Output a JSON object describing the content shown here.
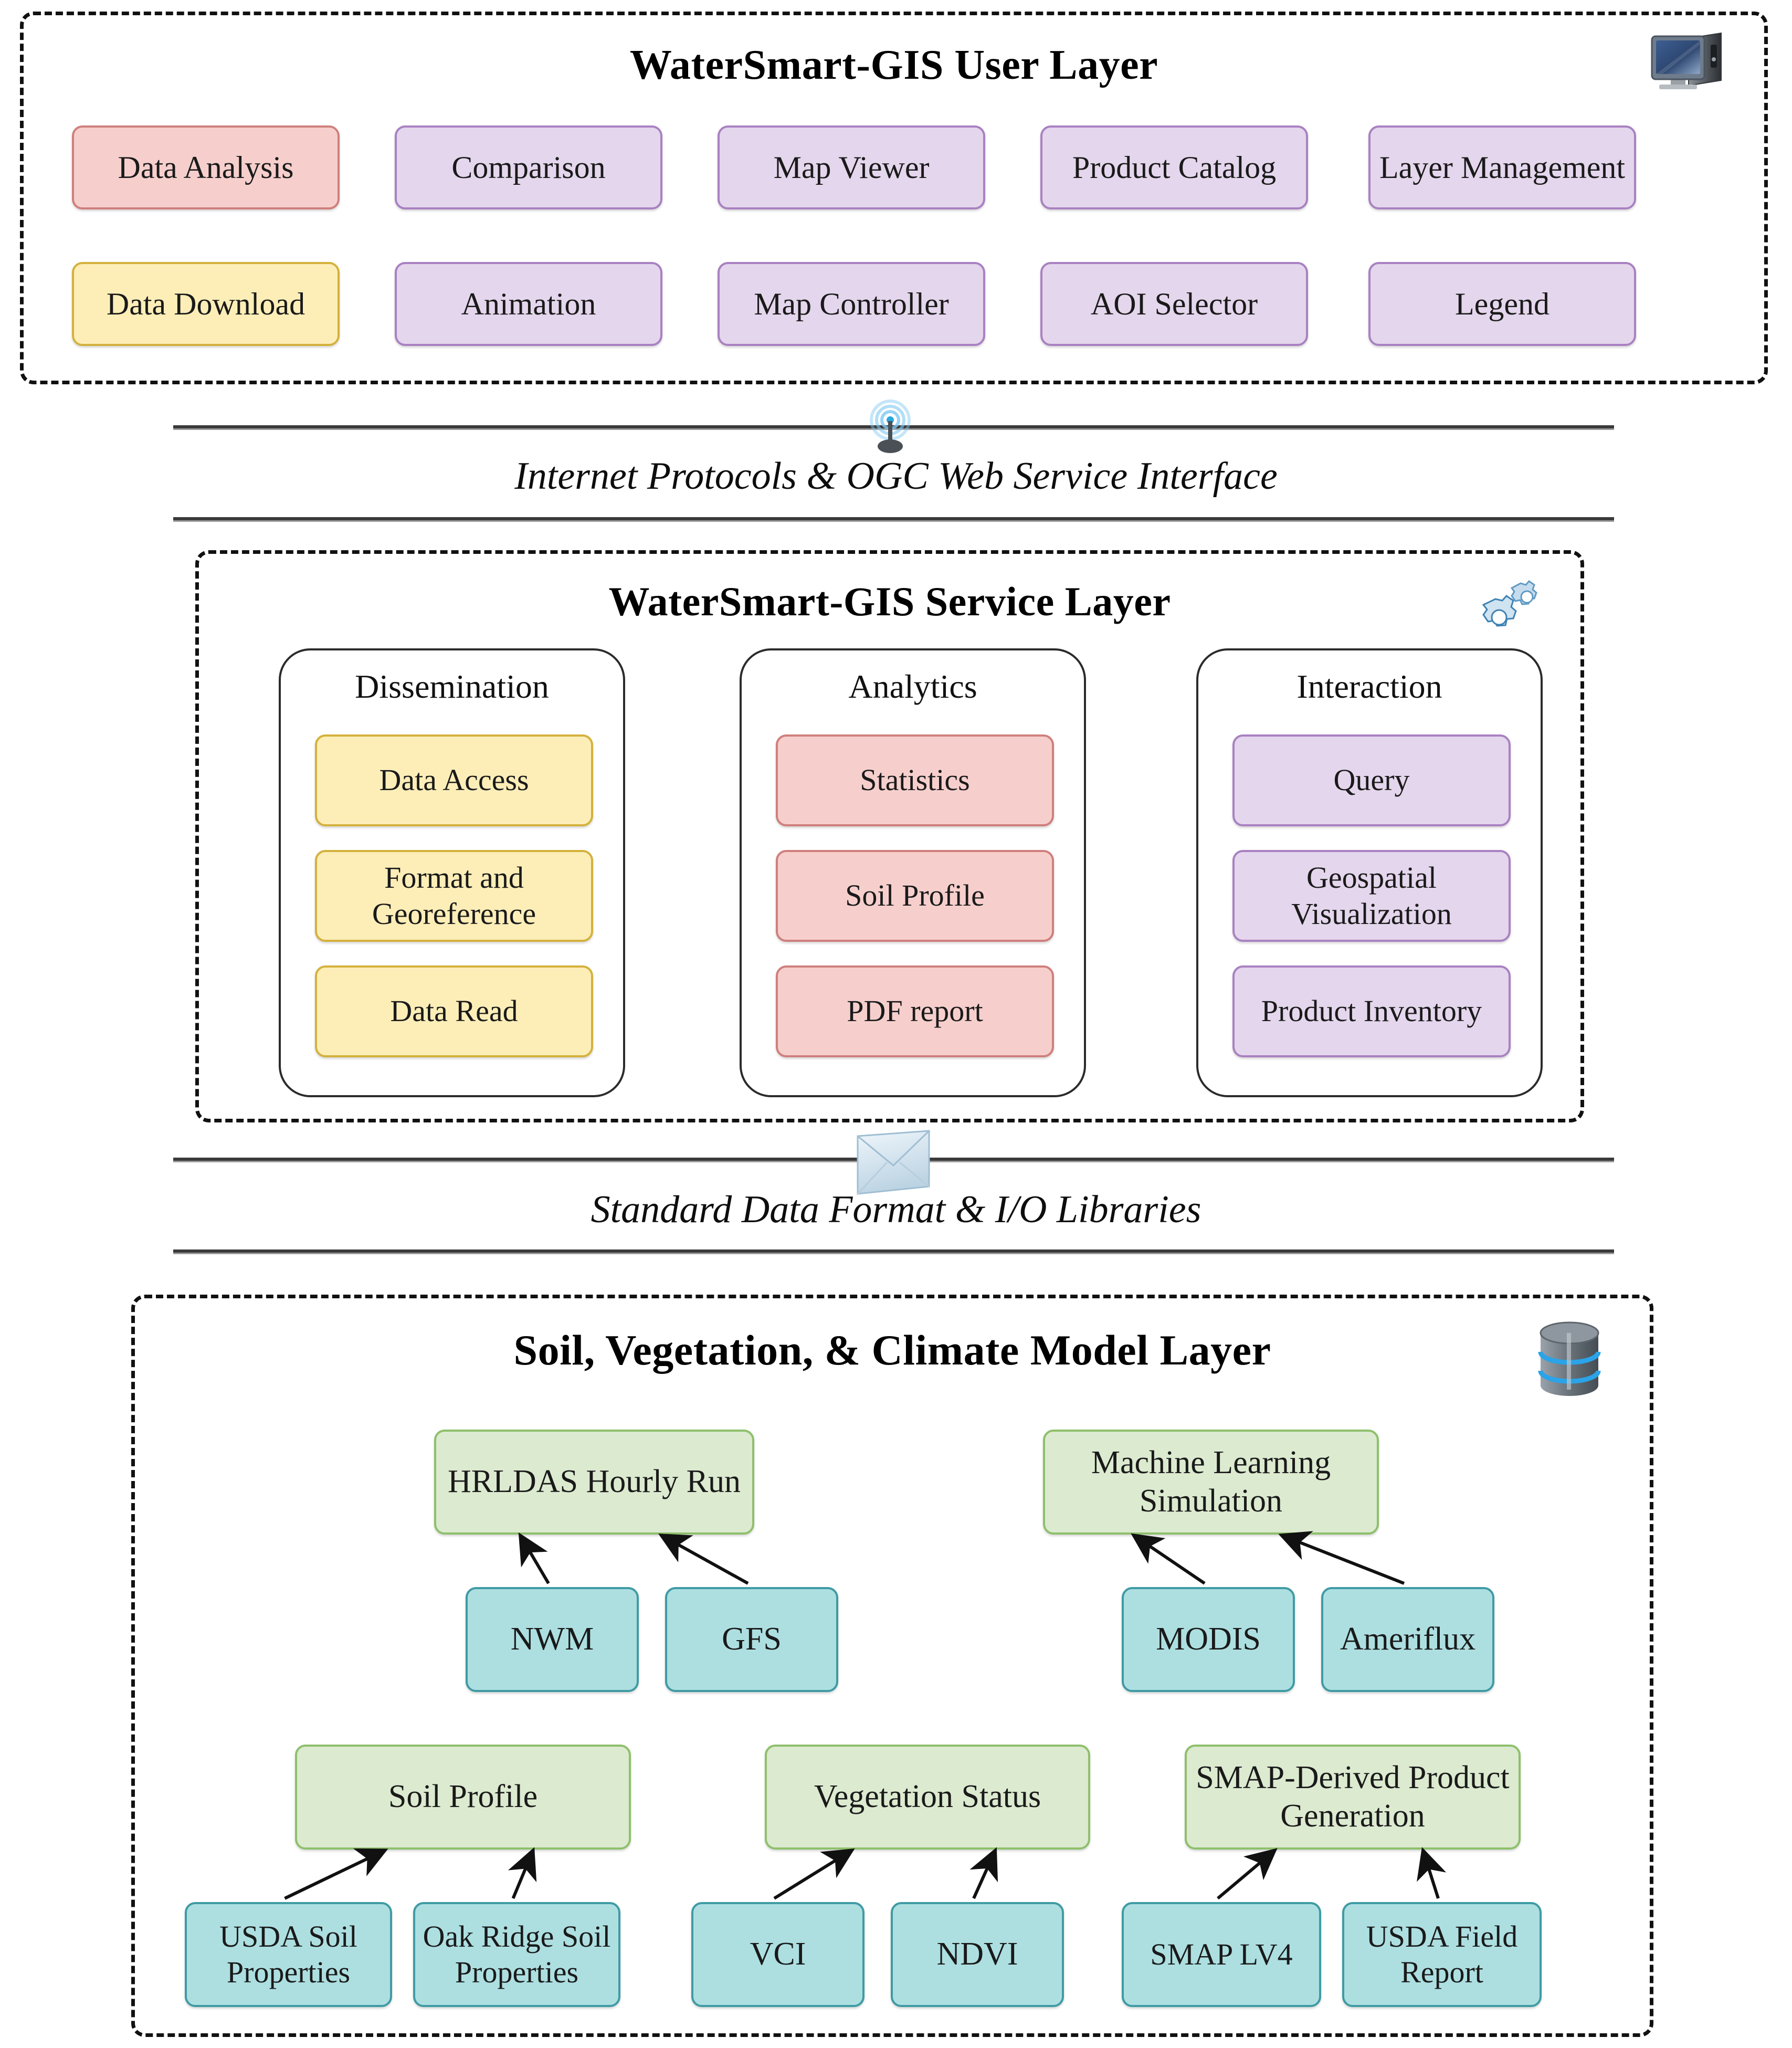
{
  "user_layer": {
    "title": "WaterSmart-GIS User Layer",
    "icon": "desktop-computer-icon",
    "row1": [
      {
        "label": "Data Analysis",
        "color": "pink"
      },
      {
        "label": "Comparison",
        "color": "purple"
      },
      {
        "label": "Map Viewer",
        "color": "purple"
      },
      {
        "label": "Product Catalog",
        "color": "purple"
      },
      {
        "label": "Layer Management",
        "color": "purple"
      }
    ],
    "row2": [
      {
        "label": "Data Download",
        "color": "yellow"
      },
      {
        "label": "Animation",
        "color": "purple"
      },
      {
        "label": "Map Controller",
        "color": "purple"
      },
      {
        "label": "AOI Selector",
        "color": "purple"
      },
      {
        "label": "Legend",
        "color": "purple"
      }
    ]
  },
  "interface_top": {
    "label": "Internet Protocols & OGC Web Service Interface",
    "icon": "wireless-broadcast-icon"
  },
  "service_layer": {
    "title": "WaterSmart-GIS Service Layer",
    "icon": "gears-icon",
    "groups": [
      {
        "name": "Dissemination",
        "items": [
          {
            "label": "Data Access",
            "color": "yellow"
          },
          {
            "label": "Format and Georeference",
            "color": "yellow"
          },
          {
            "label": "Data Read",
            "color": "yellow"
          }
        ]
      },
      {
        "name": "Analytics",
        "items": [
          {
            "label": "Statistics",
            "color": "pink"
          },
          {
            "label": "Soil Profile",
            "color": "pink"
          },
          {
            "label": "PDF report",
            "color": "pink"
          }
        ]
      },
      {
        "name": "Interaction",
        "items": [
          {
            "label": "Query",
            "color": "purple"
          },
          {
            "label": "Geospatial Visualization",
            "color": "purple"
          },
          {
            "label": "Product Inventory",
            "color": "purple"
          }
        ]
      }
    ]
  },
  "interface_bottom": {
    "label": "Standard Data Format & I/O Libraries",
    "icon": "envelope-icon"
  },
  "model_layer": {
    "title": "Soil, Vegetation, & Climate Model Layer",
    "icon": "database-icon",
    "processes": [
      {
        "label": "HRLDAS Hourly Run",
        "color": "green"
      },
      {
        "label": "Machine Learning Simulation",
        "color": "green"
      },
      {
        "label": "Soil Profile",
        "color": "green"
      },
      {
        "label": "Vegetation Status",
        "color": "green"
      },
      {
        "label": "SMAP-Derived Product Generation",
        "color": "green"
      }
    ],
    "sources": [
      {
        "label": "NWM",
        "color": "cyan",
        "feeds": "HRLDAS Hourly Run"
      },
      {
        "label": "GFS",
        "color": "cyan",
        "feeds": "HRLDAS Hourly Run"
      },
      {
        "label": "MODIS",
        "color": "cyan",
        "feeds": "Machine Learning Simulation"
      },
      {
        "label": "Ameriflux",
        "color": "cyan",
        "feeds": "Machine Learning Simulation"
      },
      {
        "label": "USDA Soil Properties",
        "color": "cyan",
        "feeds": "Soil Profile"
      },
      {
        "label": "Oak Ridge Soil Properties",
        "color": "cyan",
        "feeds": "Soil Profile"
      },
      {
        "label": "VCI",
        "color": "cyan",
        "feeds": "Vegetation Status"
      },
      {
        "label": "NDVI",
        "color": "cyan",
        "feeds": "Vegetation Status"
      },
      {
        "label": "SMAP LV4",
        "color": "cyan",
        "feeds": "SMAP-Derived Product Generation"
      },
      {
        "label": "USDA Field Report",
        "color": "cyan",
        "feeds": "SMAP-Derived Product Generation"
      }
    ]
  },
  "colors": {
    "pink_fill": "#f6cfcd",
    "pink_border": "#cf7f7c",
    "purple_fill": "#e4d6ec",
    "purple_border": "#a981c2",
    "yellow_fill": "#fdeeb8",
    "yellow_border": "#d4b13c",
    "green_fill": "#dcead0",
    "green_border": "#8ec06b",
    "cyan_fill": "#addfe1",
    "cyan_border": "#3f9ba4",
    "outline": "#111111"
  }
}
